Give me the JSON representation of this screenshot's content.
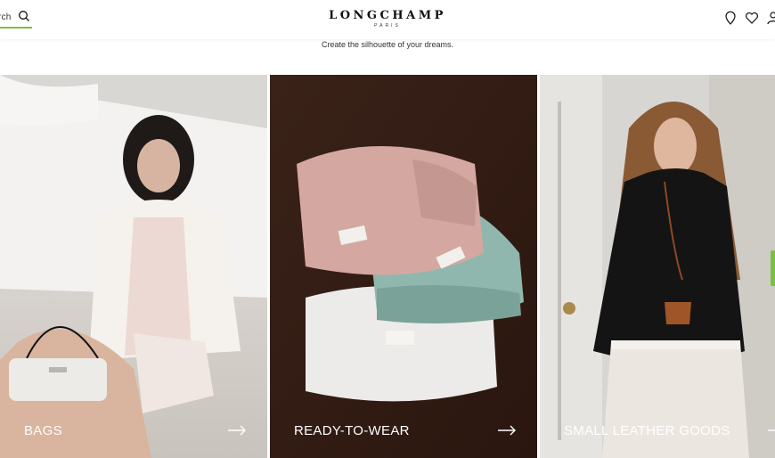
{
  "header": {
    "search_label": "rch",
    "logo": "LONGCHAMP",
    "logo_sub": "PARIS"
  },
  "tagline": "Create the silhouette of your dreams.",
  "tiles": [
    {
      "label": "BAGS"
    },
    {
      "label": "READY-TO-WEAR"
    },
    {
      "label": "SMALL LEATHER GOODS"
    }
  ],
  "colors": {
    "accent": "#7ac143"
  }
}
